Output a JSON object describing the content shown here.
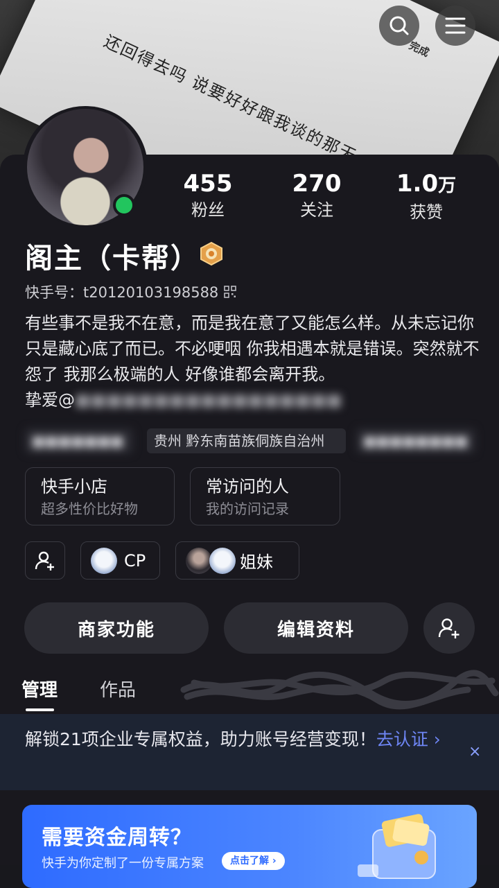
{
  "cover": {
    "handwriting": "还回得去吗 说要好好跟我谈的那天",
    "done_label": "完成"
  },
  "header_icons": [
    "search-icon",
    "menu-icon"
  ],
  "stats": [
    {
      "num": "455",
      "label": "粉丝"
    },
    {
      "num": "270",
      "label": "关注"
    },
    {
      "num": "1.0",
      "unit": "万",
      "label": "获赞"
    }
  ],
  "profile": {
    "name": "阁主（卡帮）",
    "kuaishou_id": "快手号：t20120103198588",
    "bio_line": "有些事不是我不在意，而是我在意了又能怎么样。从未忘记你 只是藏心底了而已。不必哽咽 你我相遇本就是错误。突然就不怨了 我那么极端的人 好像谁都会离开我。",
    "bio_tail_prefix": "挚爱@",
    "bio_tail_blur": "■■■■■■■■■■■■■■■■■"
  },
  "tags": {
    "left_blur": "■■■■■■■",
    "location": "贵州 黔东南苗族侗族自治州",
    "right_blur": "■■■■■■■■"
  },
  "cards": [
    {
      "title": "快手小店",
      "sub": "超多性价比好物"
    },
    {
      "title": "常访问的人",
      "sub": "我的访问记录"
    }
  ],
  "chips": {
    "cp": "CP",
    "sister": "姐妹"
  },
  "buttons": {
    "merchant": "商家功能",
    "edit": "编辑资料"
  },
  "tabs": {
    "manage": "管理",
    "works": "作品"
  },
  "banner": {
    "text": "解锁21项企业专属权益，助力账号经营变现！",
    "link": "去认证 ›",
    "close": "×"
  },
  "finance": {
    "title": "需要资金周转？",
    "sub": "快手为你定制了一份专属方案",
    "cta": "点击了解 ›"
  },
  "colors": {
    "accent": "#6e86f5",
    "online": "#22c55e",
    "panel": "#19181e"
  }
}
